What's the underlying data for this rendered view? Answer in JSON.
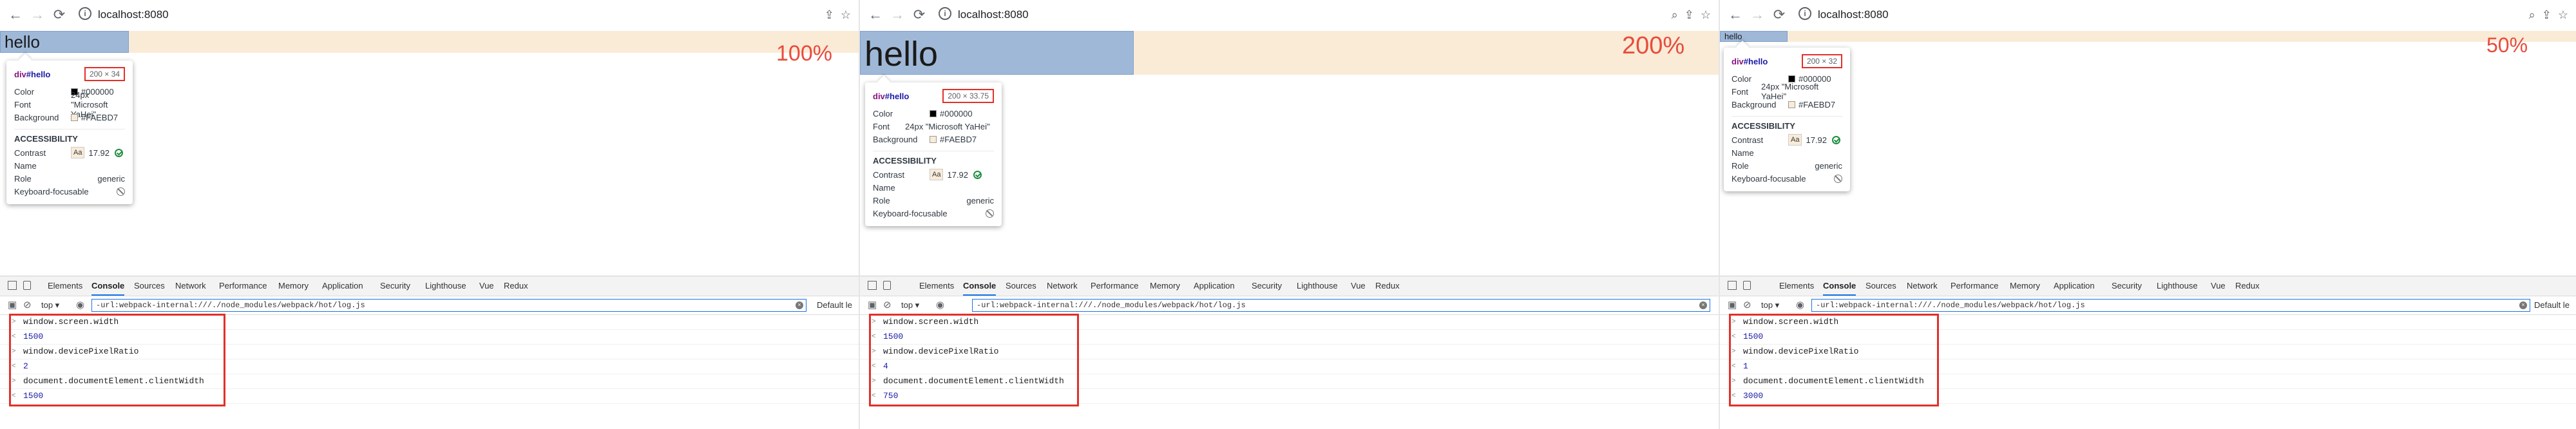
{
  "panels": [
    {
      "url": "localhost:8080",
      "hello": "hello",
      "zoom": "100%",
      "tooltip": {
        "selector_tag": "div",
        "selector_id": "#hello",
        "dims": "200 × 34",
        "color_label": "Color",
        "color_value": "#000000",
        "font_label": "Font",
        "font_value": "24px \"Microsoft YaHei\"",
        "bg_label": "Background",
        "bg_value": "#FAEBD7",
        "accessibility": "ACCESSIBILITY",
        "contrast_label": "Contrast",
        "aa": "Aa",
        "contrast_value": "17.92",
        "name_label": "Name",
        "role_label": "Role",
        "role_value": "generic",
        "kf_label": "Keyboard-focusable"
      },
      "console": [
        "window.screen.width",
        "1500",
        "window.devicePixelRatio",
        "2",
        "document.documentElement.clientWidth",
        "1500"
      ]
    },
    {
      "url": "localhost:8080",
      "hello": "hello",
      "zoom": "200%",
      "tooltip": {
        "selector_tag": "div",
        "selector_id": "#hello",
        "dims": "200 × 33.75",
        "color_label": "Color",
        "color_value": "#000000",
        "font_label": "Font",
        "font_value": "24px \"Microsoft YaHei\"",
        "bg_label": "Background",
        "bg_value": "#FAEBD7",
        "accessibility": "ACCESSIBILITY",
        "contrast_label": "Contrast",
        "aa": "Aa",
        "contrast_value": "17.92",
        "name_label": "Name",
        "role_label": "Role",
        "role_value": "generic",
        "kf_label": "Keyboard-focusable"
      },
      "console": [
        "window.screen.width",
        "1500",
        "window.devicePixelRatio",
        "4",
        "document.documentElement.clientWidth",
        "750"
      ]
    },
    {
      "url": "localhost:8080",
      "hello": "hello",
      "zoom": "50%",
      "tooltip": {
        "selector_tag": "div",
        "selector_id": "#hello",
        "dims": "200 × 32",
        "color_label": "Color",
        "color_value": "#000000",
        "font_label": "Font",
        "font_value": "24px \"Microsoft YaHei\"",
        "bg_label": "Background",
        "bg_value": "#FAEBD7",
        "accessibility": "ACCESSIBILITY",
        "contrast_label": "Contrast",
        "aa": "Aa",
        "contrast_value": "17.92",
        "name_label": "Name",
        "role_label": "Role",
        "role_value": "generic",
        "kf_label": "Keyboard-focusable"
      },
      "console": [
        "window.screen.width",
        "1500",
        "window.devicePixelRatio",
        "1",
        "document.documentElement.clientWidth",
        "3000"
      ]
    }
  ],
  "devtools": {
    "tabs": [
      "Elements",
      "Console",
      "Sources",
      "Network",
      "Performance",
      "Memory",
      "Application",
      "Security",
      "Lighthouse",
      "Vue",
      "Redux"
    ],
    "active_tab": "Console",
    "context": "top ▾",
    "filter": "-url:webpack-internal:///./node_modules/webpack/hot/log.js",
    "levels": "Default le"
  },
  "colors": {
    "bar_bg": "#FAEBD7",
    "hello_box": "#9fb8d8",
    "zoom_text": "#e74c3c",
    "highlight_box": "#e0312b",
    "contrast_ok": "#1e8e3e"
  }
}
